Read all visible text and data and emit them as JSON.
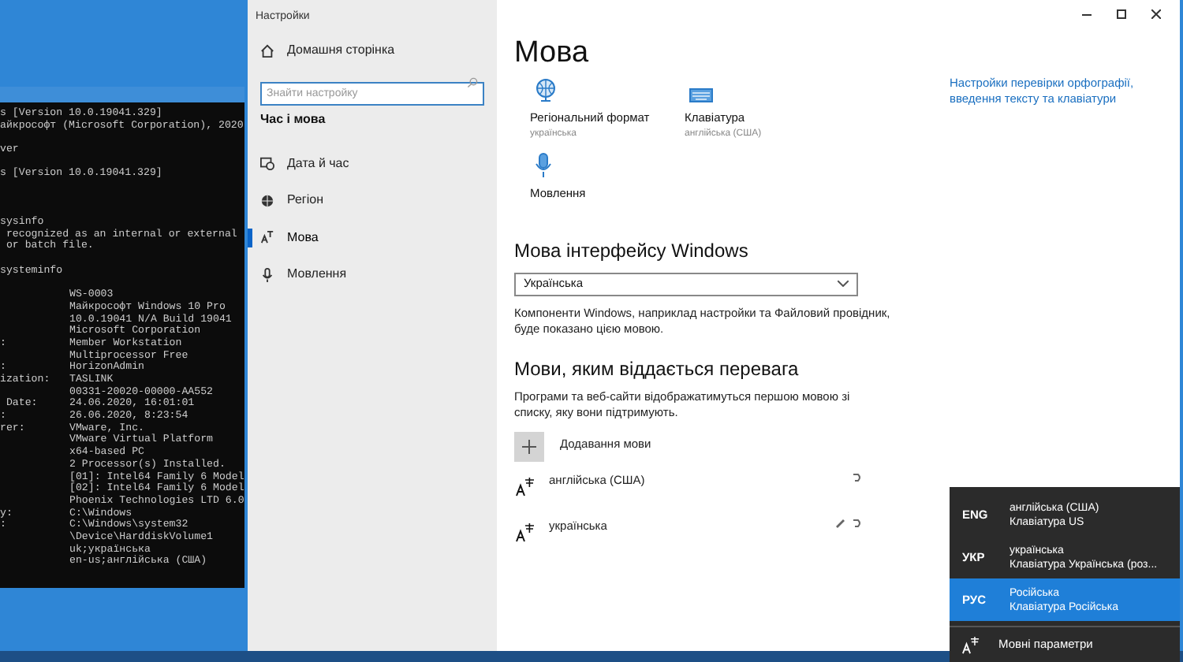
{
  "console": {
    "lines": [
      {
        "kind": "text",
        "left": "s [Version 10.0.19041.329]"
      },
      {
        "kind": "text",
        "left": "айкрософт (Microsoft Corporation), 2020"
      },
      {
        "kind": "blank"
      },
      {
        "kind": "text",
        "left": "ver"
      },
      {
        "kind": "blank"
      },
      {
        "kind": "text",
        "left": "s [Version 10.0.19041.329]"
      },
      {
        "kind": "blank"
      },
      {
        "kind": "blank"
      },
      {
        "kind": "blank"
      },
      {
        "kind": "text",
        "left": "sysinfo"
      },
      {
        "kind": "text",
        "left": " recognized as an internal or external"
      },
      {
        "kind": "text",
        "left": " or batch file."
      },
      {
        "kind": "blank"
      },
      {
        "kind": "text",
        "left": "systeminfo"
      },
      {
        "kind": "blank"
      },
      {
        "kind": "text",
        "right": "WS-0003"
      },
      {
        "kind": "text",
        "right": "Майкрософт Windows 10 Pro"
      },
      {
        "kind": "text",
        "right": "10.0.19041 N/A Build 19041"
      },
      {
        "kind": "text",
        "right": "Microsoft Corporation"
      },
      {
        "kind": "text",
        "left": ":",
        "right": "Member Workstation"
      },
      {
        "kind": "text",
        "right": "Multiprocessor Free"
      },
      {
        "kind": "text",
        "left": ":",
        "right": "HorizonAdmin"
      },
      {
        "kind": "text",
        "left": "ization:",
        "right": "TASLINK"
      },
      {
        "kind": "text",
        "right": "00331-20020-00000-AA552"
      },
      {
        "kind": "text",
        "left": " Date:",
        "right": "24.06.2020, 16:01:01"
      },
      {
        "kind": "text",
        "left": ":",
        "right": "26.06.2020, 8:23:54"
      },
      {
        "kind": "text",
        "left": "rer:",
        "right": "VMware, Inc."
      },
      {
        "kind": "text",
        "right": "VMware Virtual Platform"
      },
      {
        "kind": "text",
        "right": "x64-based PC"
      },
      {
        "kind": "text",
        "right": "2 Processor(s) Installed."
      },
      {
        "kind": "text",
        "right": "[01]: Intel64 Family 6 Model"
      },
      {
        "kind": "text",
        "right": "[02]: Intel64 Family 6 Model"
      },
      {
        "kind": "text",
        "right": "Phoenix Technologies LTD 6.0"
      },
      {
        "kind": "text",
        "left": "y:",
        "right": "C:\\Windows"
      },
      {
        "kind": "text",
        "left": ":",
        "right": "C:\\Windows\\system32"
      },
      {
        "kind": "text",
        "right": "\\Device\\HarddiskVolume1"
      },
      {
        "kind": "text",
        "right": "uk;українська"
      },
      {
        "kind": "text",
        "right": "en-us;англійська (США)"
      }
    ]
  },
  "window": {
    "title": "Настройки"
  },
  "sidebar": {
    "home": "Домашня сторінка",
    "search": {
      "placeholder": "Знайти настройку"
    },
    "section": "Час і мова",
    "items": [
      {
        "label": "Дата й час",
        "kind": "clock",
        "selected": false
      },
      {
        "label": "Регіон",
        "kind": "globe",
        "selected": false
      },
      {
        "label": "Мова",
        "kind": "language",
        "selected": true
      },
      {
        "label": "Мовлення",
        "kind": "mic",
        "selected": false
      }
    ]
  },
  "page": {
    "title": "Мова",
    "shortcuts": [
      {
        "label": "Регіональний формат",
        "value": "українська",
        "kind": "globe"
      },
      {
        "label": "Клавіатура",
        "value": "англійська (США)",
        "kind": "keyboard"
      },
      {
        "label": "Мовлення",
        "kind": "mic"
      }
    ],
    "link": "Настройки перевірки орфографії, введення тексту та клавіатури",
    "display_language": {
      "heading": "Мова інтерфейсу Windows",
      "value": "Українська",
      "description": "Компоненти Windows, наприклад настройки та Файловий провідник, буде показано цією мовою."
    },
    "preferred": {
      "heading": "Мови, яким віддається перевага",
      "description": "Програми та веб-сайти відображатимуться першою мовою зі списку, яку вони підтримують.",
      "add": "Додавання мови",
      "languages": [
        {
          "name": "англійська (США)",
          "has_keyboard": false
        },
        {
          "name": "українська",
          "has_keyboard": true
        }
      ]
    }
  },
  "flyout": {
    "items": [
      {
        "code": "ENG",
        "language": "англійська (США)",
        "keyboard": "Клавіатура US",
        "selected": false
      },
      {
        "code": "УКР",
        "language": "українська",
        "keyboard": "Клавіатура Українська (роз...",
        "selected": false
      },
      {
        "code": "РУС",
        "language": "Російська",
        "keyboard": "Клавіатура Російська",
        "selected": true
      }
    ],
    "settings": "Мовні параметри"
  }
}
